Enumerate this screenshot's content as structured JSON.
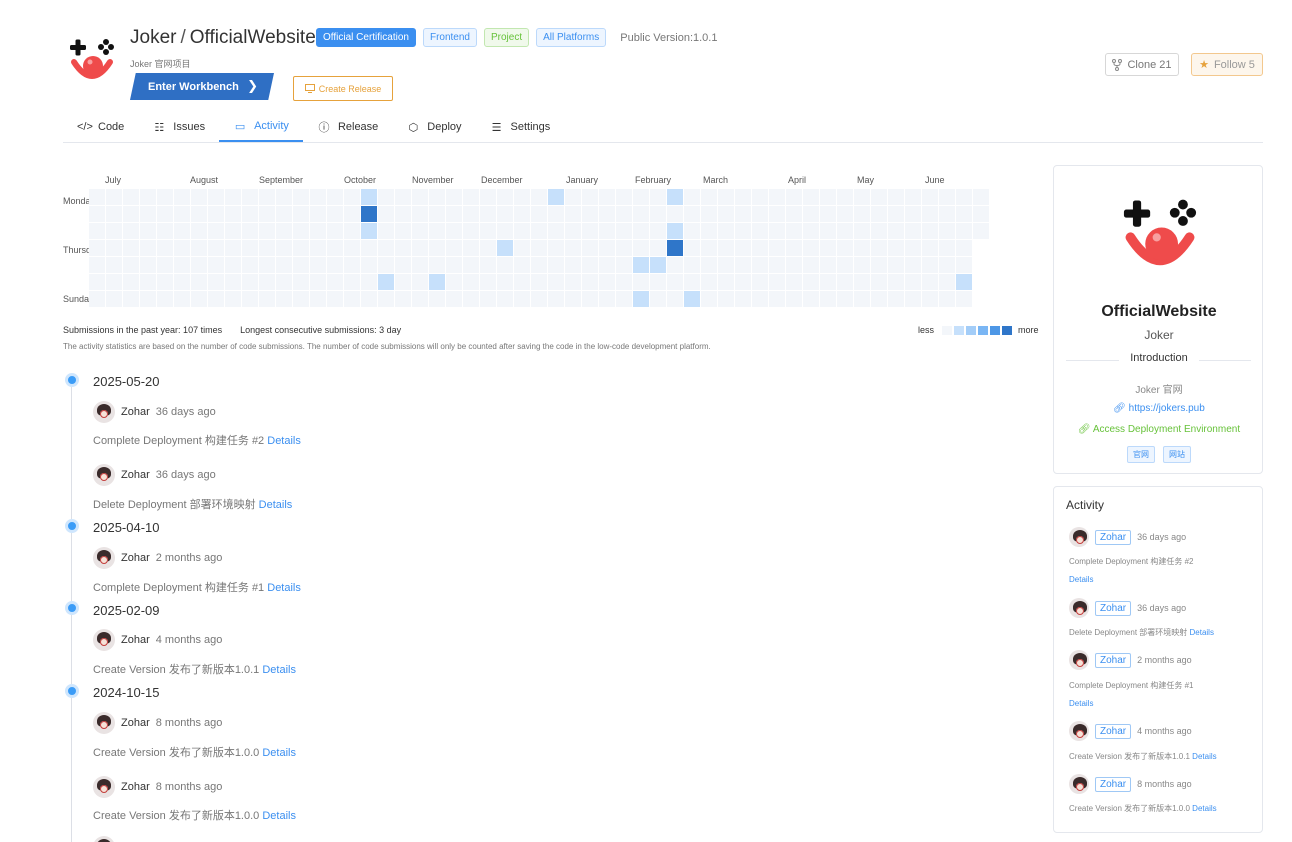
{
  "repo": {
    "owner": "Joker",
    "separator": "/",
    "name": "OfficialWebsite",
    "subtitle": "Joker 官网项目",
    "tags": [
      "Official Certification",
      "Frontend",
      "Project",
      "All Platforms"
    ],
    "public_version": "Public Version:1.0.1"
  },
  "actions": {
    "workbench_label": "Enter Workbench",
    "create_release_label": "Create Release",
    "clone_label": "Clone 21",
    "follow_label": "Follow 5"
  },
  "tabs": [
    {
      "label": "Code",
      "icon": "code-icon"
    },
    {
      "label": "Issues",
      "icon": "list-icon"
    },
    {
      "label": "Activity",
      "icon": "message-icon",
      "active": true
    },
    {
      "label": "Release",
      "icon": "info-icon"
    },
    {
      "label": "Deploy",
      "icon": "cube-icon"
    },
    {
      "label": "Settings",
      "icon": "sliders-icon"
    }
  ],
  "heatmap": {
    "months": [
      "July",
      "August",
      "September",
      "October",
      "November",
      "December",
      "January",
      "February",
      "March",
      "April",
      "May",
      "June"
    ],
    "days": [
      "Monday",
      "Thursday",
      "Sunday"
    ],
    "colors": [
      "#f3f6fa",
      "#c6e0fb",
      "#a3cdf8",
      "#7ab6f4",
      "#4d97e6",
      "#2f76c9"
    ],
    "active_cells": [
      {
        "week": 16,
        "day": 0,
        "level": 1
      },
      {
        "week": 16,
        "day": 1,
        "level": 5
      },
      {
        "week": 16,
        "day": 2,
        "level": 1
      },
      {
        "week": 27,
        "day": 0,
        "level": 1
      },
      {
        "week": 34,
        "day": 0,
        "level": 1
      },
      {
        "week": 34,
        "day": 2,
        "level": 1
      },
      {
        "week": 34,
        "day": 3,
        "level": 5
      },
      {
        "week": 24,
        "day": 3,
        "level": 1
      },
      {
        "week": 32,
        "day": 4,
        "level": 1
      },
      {
        "week": 33,
        "day": 4,
        "level": 1
      },
      {
        "week": 17,
        "day": 5,
        "level": 1
      },
      {
        "week": 20,
        "day": 5,
        "level": 1
      },
      {
        "week": 51,
        "day": 5,
        "level": 1
      },
      {
        "week": 32,
        "day": 6,
        "level": 1
      },
      {
        "week": 35,
        "day": 6,
        "level": 1
      }
    ],
    "stats_submissions": "Submissions in the past year: 107 times",
    "stats_longest": "Longest consecutive submissions: 3 day",
    "legend_less": "less",
    "legend_more": "more",
    "note": "The activity statistics are based on the number of code submissions. The number of code submissions will only be counted after saving the code in the low-code development platform."
  },
  "timeline": [
    {
      "date": "2025-05-20",
      "entries": [
        {
          "user": "Zohar",
          "ago": "36 days ago",
          "action": "Complete Deployment 构建任务 #2",
          "link": "Details"
        },
        {
          "user": "Zohar",
          "ago": "36 days ago",
          "action": "Delete Deployment 部署环境映射",
          "link": "Details"
        }
      ]
    },
    {
      "date": "2025-04-10",
      "entries": [
        {
          "user": "Zohar",
          "ago": "2 months ago",
          "action": "Complete Deployment 构建任务 #1",
          "link": "Details"
        }
      ]
    },
    {
      "date": "2025-02-09",
      "entries": [
        {
          "user": "Zohar",
          "ago": "4 months ago",
          "action": "Create Version 发布了新版本1.0.1",
          "link": "Details"
        }
      ]
    },
    {
      "date": "2024-10-15",
      "entries": [
        {
          "user": "Zohar",
          "ago": "8 months ago",
          "action": "Create Version 发布了新版本1.0.0",
          "link": "Details"
        },
        {
          "user": "Zohar",
          "ago": "8 months ago",
          "action": "Create Version 发布了新版本1.0.0",
          "link": "Details"
        }
      ]
    }
  ],
  "sidebar": {
    "name": "OfficialWebsite",
    "owner": "Joker",
    "intro_label": "Introduction",
    "description": "Joker 官网",
    "url": "https://jokers.pub",
    "env_link": "Access Deployment Environment",
    "tags": [
      "官网",
      "网站"
    ]
  },
  "activity": {
    "title": "Activity",
    "items": [
      {
        "user": "Zohar",
        "ago": "36 days ago",
        "text": "Complete Deployment  构建任务 #2",
        "link": "Details"
      },
      {
        "user": "Zohar",
        "ago": "36 days ago",
        "text": "Delete Deployment  部署环境映射",
        "link": "Details"
      },
      {
        "user": "Zohar",
        "ago": "2 months ago",
        "text": "Complete Deployment  构建任务 #1",
        "link": "Details"
      },
      {
        "user": "Zohar",
        "ago": "4 months ago",
        "text": "Create Version  发布了新版本1.0.1",
        "link": "Details"
      },
      {
        "user": "Zohar",
        "ago": "8 months ago",
        "text": "Create Version  发布了新版本1.0.0",
        "link": "Details"
      }
    ]
  }
}
